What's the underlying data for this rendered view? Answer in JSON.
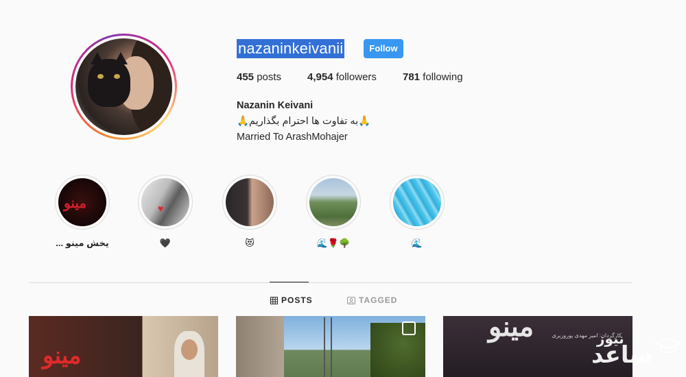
{
  "profile": {
    "username": "nazaninkeivanii",
    "follow_label": "Follow",
    "stats": {
      "posts_count": "455",
      "posts_label": "posts",
      "followers_count": "4,954",
      "followers_label": "followers",
      "following_count": "781",
      "following_label": "following"
    },
    "full_name": "Nazanin Keivani",
    "bio_line1": "🙏به تفاوت ها احترام بگذاریم🙏",
    "bio_line2": "Married To ArashMohajer"
  },
  "highlights": [
    {
      "label": "... یخش مینو",
      "image_text": "مینو"
    },
    {
      "label": "🖤",
      "image_text": "♥"
    },
    {
      "label": "😻"
    },
    {
      "label": "🌊🌹🌳"
    },
    {
      "label": "🌊"
    }
  ],
  "tabs": {
    "posts_label": "POSTS",
    "tagged_label": "TAGGED"
  },
  "posts": [
    {
      "title_text": "مینو"
    },
    {},
    {
      "title_text": "مینو",
      "credits": "کارگردان: امیر مهدی پوروزیری"
    }
  ],
  "watermark": {
    "top": "نیوز",
    "main": "ساعد"
  },
  "colors": {
    "follow_button": "#3897f0",
    "selection_highlight": "#3370d6",
    "divider": "#dbdbdb",
    "background": "#fafafa"
  }
}
